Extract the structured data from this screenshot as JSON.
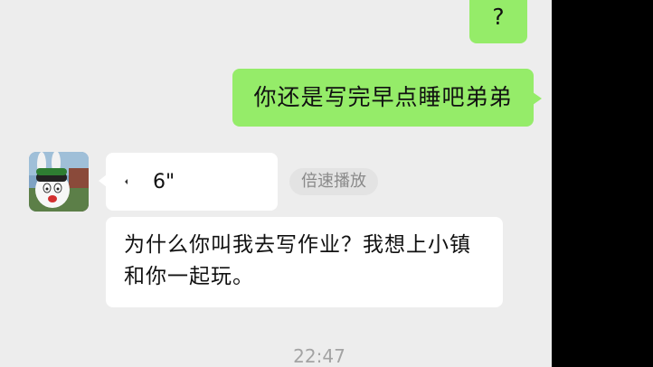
{
  "messages": {
    "outgoing_short": "?",
    "outgoing_long": "你还是写完早点睡吧弟弟",
    "voice_duration": "6\"",
    "speed_button_label": "倍速播放",
    "voice_transcript": "为什么你叫我去写作业？我想上小镇和你一起玩。"
  },
  "timestamp": "22:47",
  "colors": {
    "outgoing_bubble": "#95ec69",
    "incoming_bubble": "#ffffff",
    "chat_background": "#ededed"
  },
  "icons": {
    "voice": "voice-wave-icon",
    "avatar": "rabbid-avatar"
  }
}
